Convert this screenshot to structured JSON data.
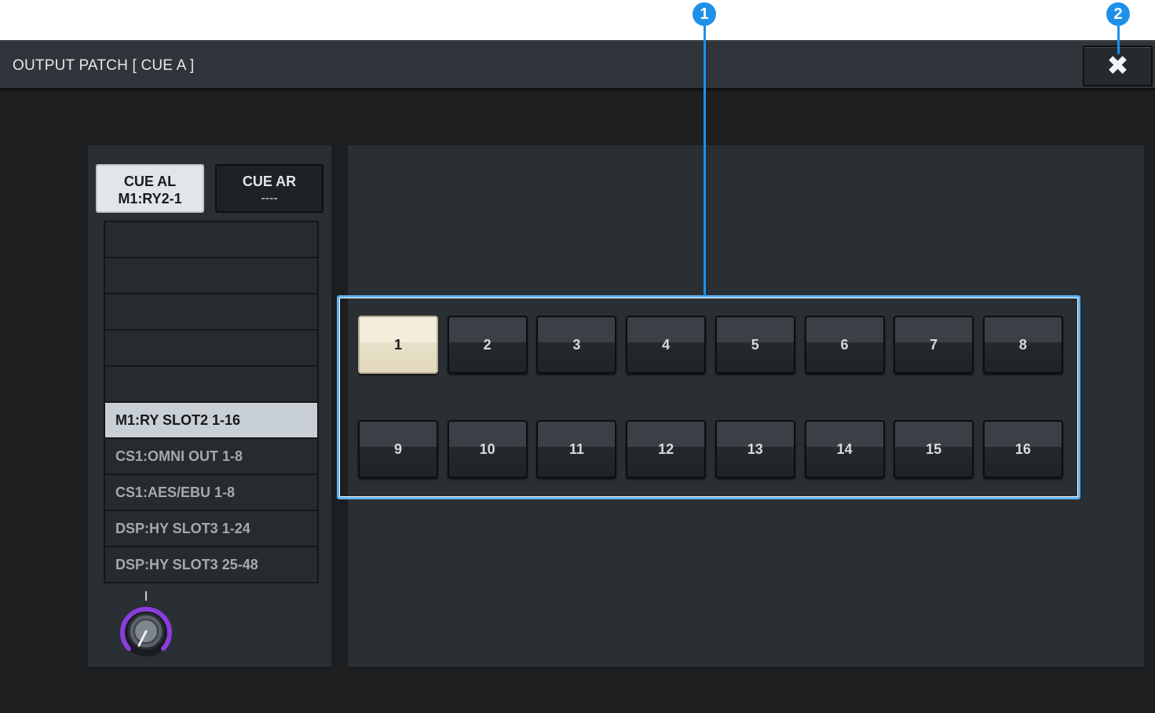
{
  "callouts": [
    "1",
    "2"
  ],
  "window": {
    "title": "OUTPUT PATCH  [ CUE A ]",
    "close_icon": "✖"
  },
  "ports": [
    {
      "name": "CUE AL",
      "patch": "M1:RY2-1",
      "active": true
    },
    {
      "name": "CUE AR",
      "patch": "----",
      "active": false
    }
  ],
  "list": {
    "rows": [
      "",
      "",
      "",
      "",
      "",
      "M1:RY SLOT2 1-16",
      "CS1:OMNI OUT 1-8",
      "CS1:AES/EBU 1-8",
      "DSP:HY SLOT3 1-24",
      "DSP:HY SLOT3 25-48"
    ],
    "selected_index": 5
  },
  "channels": {
    "labels": [
      "1",
      "2",
      "3",
      "4",
      "5",
      "6",
      "7",
      "8",
      "9",
      "10",
      "11",
      "12",
      "13",
      "14",
      "15",
      "16"
    ],
    "selected": "1"
  },
  "colors": {
    "accent_knob": "#8a3ddc",
    "callout": "#1e90e8",
    "selected_channel": "#f2eddc"
  }
}
